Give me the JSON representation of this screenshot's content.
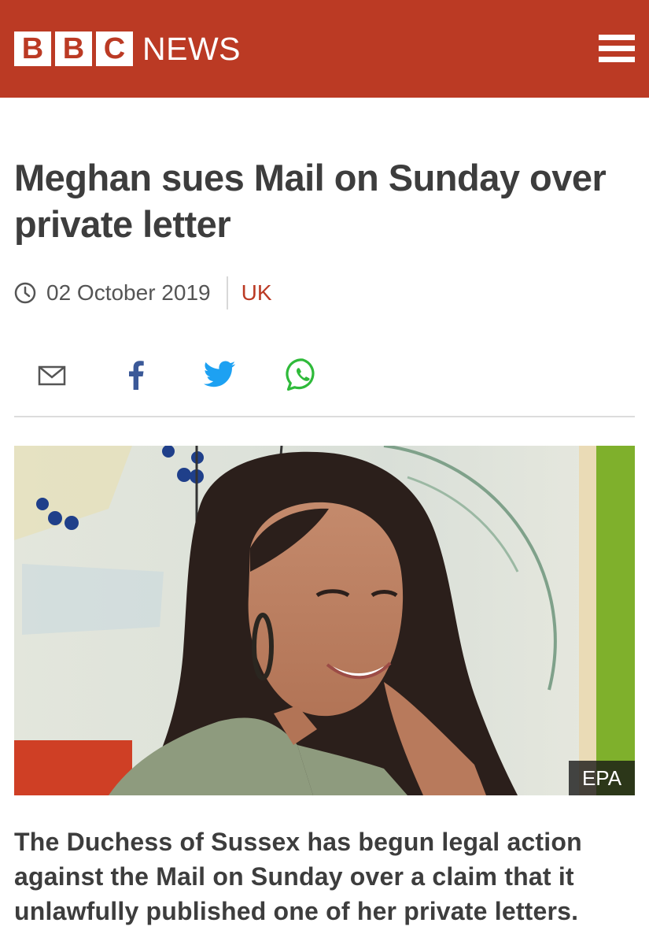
{
  "header": {
    "brand_letters": [
      "B",
      "B",
      "C"
    ],
    "brand_news": "NEWS",
    "menu_icon": "hamburger-menu-icon",
    "background_color": "#bb3a24"
  },
  "article": {
    "headline": "Meghan sues Mail on Sunday over private letter",
    "date": "02 October 2019",
    "section": "UK",
    "summary": "The Duchess of Sussex has begun legal action against the Mail on Sunday over a claim that it unlawfully published one of her private letters."
  },
  "share": {
    "icons": [
      "email-icon",
      "facebook-icon",
      "twitter-icon",
      "whatsapp-icon"
    ]
  },
  "image": {
    "credit": "EPA"
  },
  "colors": {
    "accent": "#bb3a24",
    "facebook": "#3b5998",
    "twitter": "#1da1f2",
    "whatsapp": "#2fba3a"
  }
}
